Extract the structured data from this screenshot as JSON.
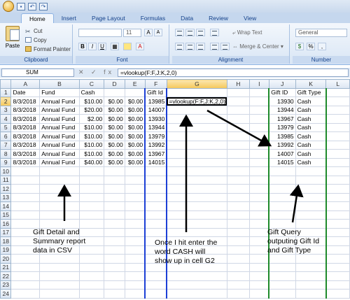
{
  "tabs": [
    "Home",
    "Insert",
    "Page Layout",
    "Formulas",
    "Data",
    "Review",
    "View"
  ],
  "ribbon": {
    "clipboard": {
      "paste": "Paste",
      "cut": "Cut",
      "copy": "Copy",
      "format_painter": "Format Painter",
      "label": "Clipboard"
    },
    "font": {
      "size": "11",
      "label": "Font",
      "bold": "B",
      "italic": "I",
      "underline": "U"
    },
    "alignment": {
      "wrap_text": "Wrap Text",
      "merge_center": "Merge & Center",
      "label": "Alignment"
    },
    "number": {
      "format": "General",
      "label": "Number"
    }
  },
  "formula_bar": {
    "name_box": "SUM",
    "icons": "✕ ✓ fx",
    "formula": "=vlookup(F:F,J:K,2,0)"
  },
  "columns": [
    "A",
    "B",
    "C",
    "D",
    "E",
    "F",
    "G",
    "H",
    "I",
    "J",
    "K",
    "L"
  ],
  "rows": [
    [
      "Date",
      "Fund",
      "Cash",
      "",
      "",
      "Gift Id",
      "",
      "",
      "",
      "Gift ID",
      "Gift Type",
      ""
    ],
    [
      "8/3/2018",
      "Annual Fund",
      "$10.00",
      "$0.00",
      "$0.00",
      "13985",
      "=vlookup(F:F,J:K,2,0)",
      "",
      "",
      "13930",
      "Cash",
      ""
    ],
    [
      "8/3/2018",
      "Annual Fund",
      "$20.00",
      "$0.00",
      "$0.00",
      "14007",
      "",
      "",
      "",
      "13944",
      "Cash",
      ""
    ],
    [
      "8/3/2018",
      "Annual Fund",
      "$2.00",
      "$0.00",
      "$0.00",
      "13930",
      "",
      "",
      "",
      "13967",
      "Cash",
      ""
    ],
    [
      "8/3/2018",
      "Annual Fund",
      "$10.00",
      "$0.00",
      "$0.00",
      "13944",
      "",
      "",
      "",
      "13979",
      "Cash",
      ""
    ],
    [
      "8/3/2018",
      "Annual Fund",
      "$10.00",
      "$0.00",
      "$0.00",
      "13979",
      "",
      "",
      "",
      "13985",
      "Cash",
      ""
    ],
    [
      "8/3/2018",
      "Annual Fund",
      "$10.00",
      "$0.00",
      "$0.00",
      "13992",
      "",
      "",
      "",
      "13992",
      "Cash",
      ""
    ],
    [
      "8/3/2018",
      "Annual Fund",
      "$10.00",
      "$0.00",
      "$0.00",
      "13967",
      "",
      "",
      "",
      "14007",
      "Cash",
      ""
    ],
    [
      "8/3/2018",
      "Annual Fund",
      "$40.00",
      "$0.00",
      "$0.00",
      "14015",
      "",
      "",
      "",
      "14015",
      "Cash",
      ""
    ]
  ],
  "empty_row_numbers": [
    "10",
    "11",
    "12",
    "13",
    "14",
    "15",
    "16",
    "17",
    "18",
    "19",
    "20",
    "21",
    "22",
    "23",
    "24"
  ],
  "annotations": {
    "left": [
      "Gift Detail and",
      "Summary report",
      "data in CSV"
    ],
    "center": [
      "Once I hit enter the",
      "word CASH will",
      "show up in cell G2"
    ],
    "right": [
      "Gift Query",
      "outputing Gift Id",
      "and Gift Type"
    ]
  }
}
